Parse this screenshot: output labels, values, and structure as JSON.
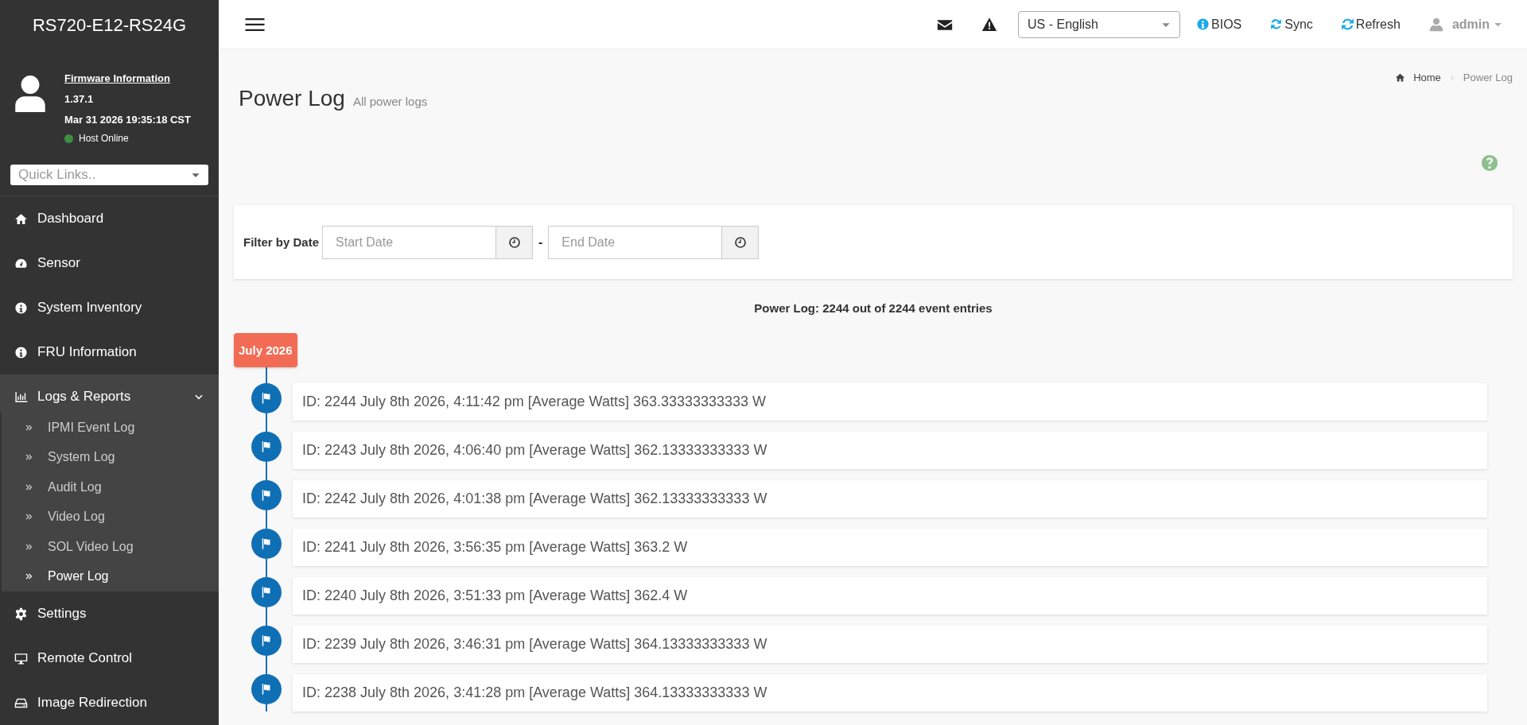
{
  "sidebar": {
    "title": "RS720-E12-RS24G",
    "firmware": {
      "link": "Firmware Information",
      "version": "1.37.1",
      "build_date": "Mar 31 2026 19:35:18 CST",
      "host_status": {
        "label": "Host Online",
        "color": "#3e8e41"
      }
    },
    "quick_links": {
      "placeholder": "Quick Links.."
    },
    "items": [
      {
        "label": "Dashboard"
      },
      {
        "label": "Sensor"
      },
      {
        "label": "System Inventory"
      },
      {
        "label": "FRU Information"
      },
      {
        "label": "Logs & Reports",
        "expanded": true,
        "children": [
          {
            "label": "IPMI Event Log",
            "selected": false
          },
          {
            "label": "System Log",
            "selected": false
          },
          {
            "label": "Audit Log",
            "selected": false
          },
          {
            "label": "Video Log",
            "selected": false
          },
          {
            "label": "SOL Video Log",
            "selected": false
          },
          {
            "label": "Power Log",
            "selected": true
          }
        ]
      },
      {
        "label": "Settings"
      },
      {
        "label": "Remote Control"
      },
      {
        "label": "Image Redirection"
      }
    ]
  },
  "top_bar": {
    "language": "US - English",
    "links": [
      {
        "label": "BIOS"
      },
      {
        "label": "Sync"
      },
      {
        "label": "Refresh"
      }
    ],
    "user": "admin"
  },
  "page": {
    "title": "Power Log",
    "subtitle": "All power logs",
    "breadcrumb": [
      "Home",
      "Power Log"
    ]
  },
  "filter": {
    "label": "Filter by Date",
    "start_placeholder": "Start Date",
    "separator": "-",
    "end_placeholder": "End Date"
  },
  "summary": "Power Log: 2244 out of 2244 event entries",
  "timeline": {
    "month": "July 2026",
    "entries": [
      "ID: 2244 July 8th 2026, 4:11:42 pm [Average Watts] 363.33333333333 W",
      "ID: 2243 July 8th 2026, 4:06:40 pm [Average Watts] 362.13333333333 W",
      "ID: 2242 July 8th 2026, 4:01:38 pm [Average Watts] 362.13333333333 W",
      "ID: 2241 July 8th 2026, 3:56:35 pm [Average Watts] 363.2 W",
      "ID: 2240 July 8th 2026, 3:51:33 pm [Average Watts] 362.4 W",
      "ID: 2239 July 8th 2026, 3:46:31 pm [Average Watts] 364.13333333333 W",
      "ID: 2238 July 8th 2026, 3:41:28 pm [Average Watts] 364.13333333333 W"
    ]
  }
}
